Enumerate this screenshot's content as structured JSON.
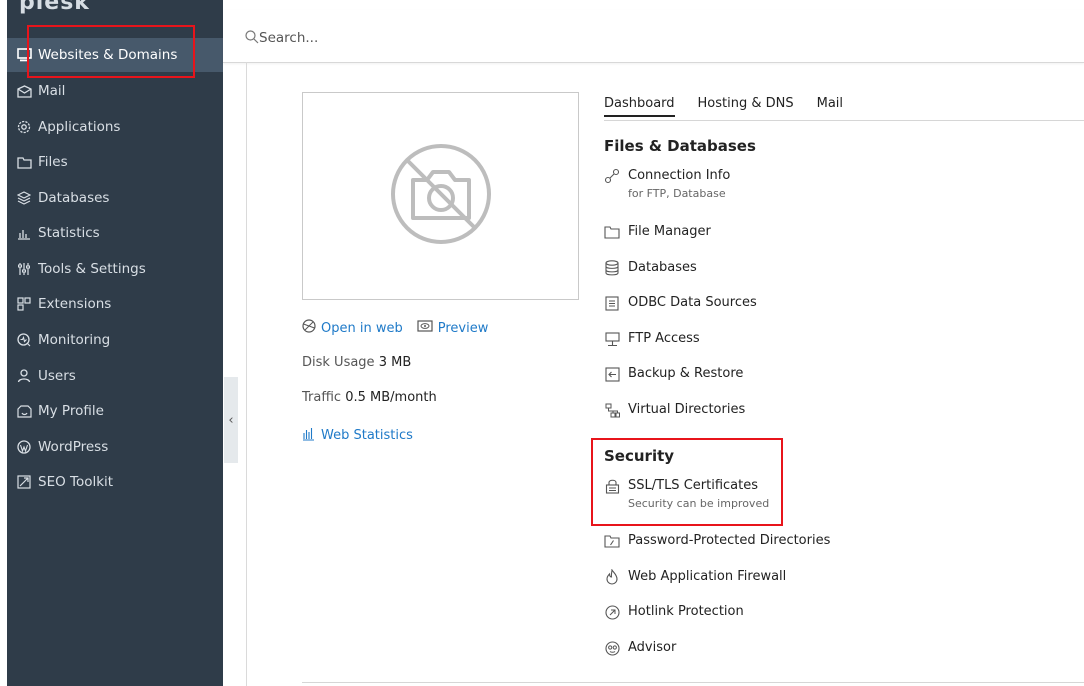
{
  "logo": {
    "text": "plesk"
  },
  "sidebar": {
    "items": [
      {
        "label": "Websites & Domains",
        "icon": "monitor-icon"
      },
      {
        "label": "Mail",
        "icon": "envelope-icon"
      },
      {
        "label": "Applications",
        "icon": "gear-icon"
      },
      {
        "label": "Files",
        "icon": "folder-icon"
      },
      {
        "label": "Databases",
        "icon": "database-icon"
      },
      {
        "label": "Statistics",
        "icon": "bar-chart-icon"
      },
      {
        "label": "Tools & Settings",
        "icon": "sliders-icon"
      },
      {
        "label": "Extensions",
        "icon": "blocks-icon"
      },
      {
        "label": "Monitoring",
        "icon": "monitoring-icon"
      },
      {
        "label": "Users",
        "icon": "user-icon"
      },
      {
        "label": "My Profile",
        "icon": "profile-icon"
      },
      {
        "label": "WordPress",
        "icon": "wordpress-icon"
      },
      {
        "label": "SEO Toolkit",
        "icon": "seo-icon"
      }
    ],
    "collapse_glyph": "‹"
  },
  "search": {
    "placeholder": "Search..."
  },
  "site": {
    "open_in_web": "Open in web",
    "preview": "Preview",
    "disk_label": "Disk Usage",
    "disk_value": "3 MB",
    "traffic_label": "Traffic",
    "traffic_value": "0.5 MB/month",
    "web_statistics": "Web Statistics"
  },
  "tabs": [
    {
      "label": "Dashboard"
    },
    {
      "label": "Hosting & DNS"
    },
    {
      "label": "Mail"
    }
  ],
  "files_section": {
    "title": "Files & Databases",
    "tools": [
      {
        "label": "Connection Info",
        "sub": "for FTP, Database",
        "icon": "link-icon"
      },
      {
        "label": "File Manager",
        "icon": "folder-icon"
      },
      {
        "label": "Databases",
        "icon": "database-icon"
      },
      {
        "label": "ODBC Data Sources",
        "icon": "odbc-icon"
      },
      {
        "label": "FTP Access",
        "icon": "ftp-icon"
      },
      {
        "label": "Backup & Restore",
        "icon": "backup-icon"
      },
      {
        "label": "Virtual Directories",
        "icon": "sitemap-icon"
      }
    ]
  },
  "security_section": {
    "title": "Security",
    "tools": [
      {
        "label": "SSL/TLS Certificates",
        "sub": "Security can be improved",
        "icon": "lock-icon"
      },
      {
        "label": "Password-Protected Directories",
        "icon": "protected-folder-icon"
      },
      {
        "label": "Web Application Firewall",
        "icon": "fire-icon"
      },
      {
        "label": "Hotlink Protection",
        "icon": "shield-icon"
      },
      {
        "label": "Advisor",
        "icon": "advisor-icon"
      }
    ]
  },
  "colors": {
    "sidebar_bg": "#2f3c49",
    "active_bg": "#47596b",
    "link": "#1f7ac8",
    "highlight": "#e8141b"
  }
}
